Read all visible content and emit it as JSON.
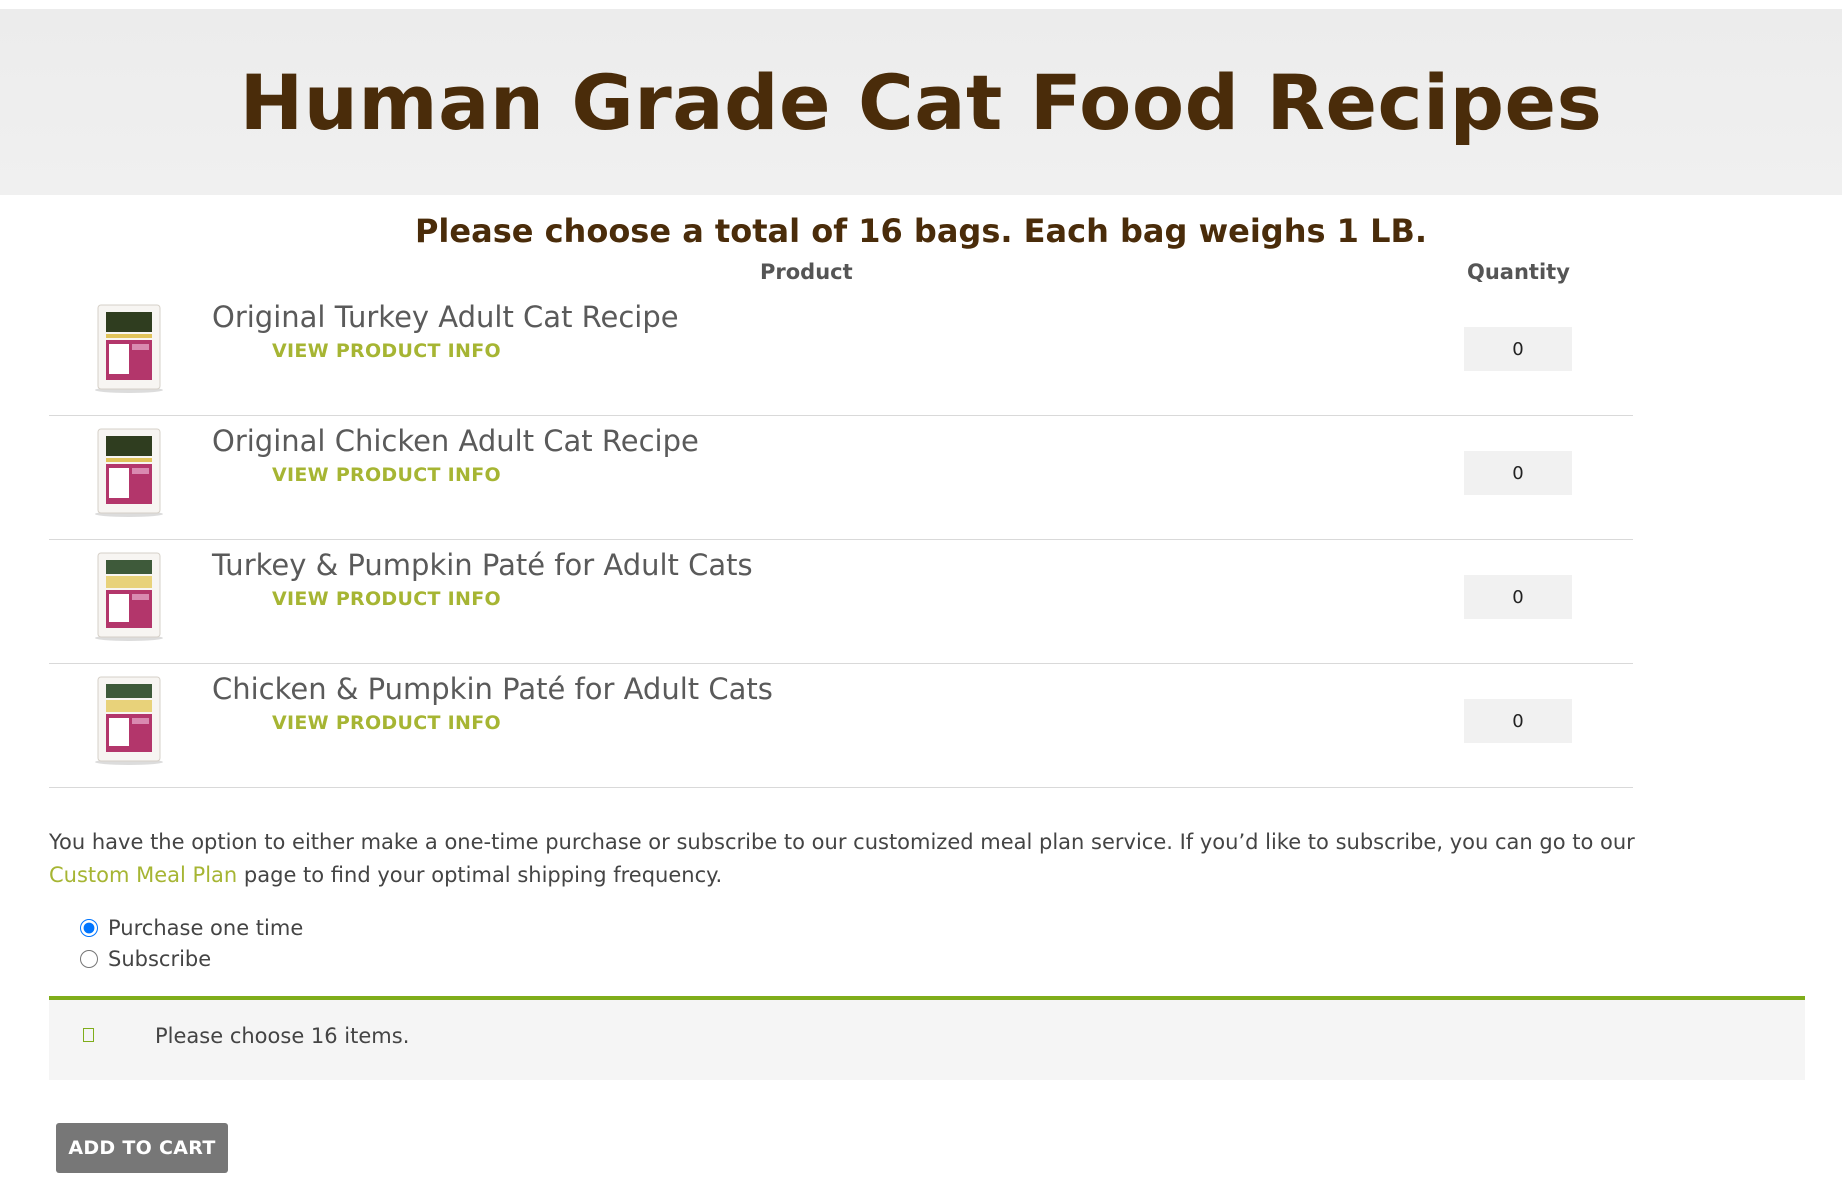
{
  "header": {
    "title": "Human Grade Cat Food Recipes"
  },
  "intro": {
    "subtitle": "Please choose a total of 16 bags. Each bag weighs 1 LB."
  },
  "table": {
    "col_product": "Product",
    "col_quantity": "Quantity",
    "rows": [
      {
        "name": "Original Turkey Adult Cat Recipe",
        "info": "VIEW PRODUCT INFO",
        "qty": "0",
        "band": "#2f3d1f"
      },
      {
        "name": "Original Chicken Adult Cat Recipe",
        "info": "VIEW PRODUCT INFO",
        "qty": "0",
        "band": "#2f3d1f"
      },
      {
        "name": "Turkey & Pumpkin Paté for Adult Cats",
        "info": "VIEW PRODUCT INFO",
        "qty": "0",
        "band": "#e8d27a"
      },
      {
        "name": "Chicken & Pumpkin Paté for Adult Cats",
        "info": "VIEW PRODUCT INFO",
        "qty": "0",
        "band": "#e8d27a"
      }
    ]
  },
  "note": {
    "text_before": "You have the option to either make a one-time purchase or subscribe to our customized meal plan service. If you’d like to subscribe, you can go to our",
    "link": "Custom Meal Plan",
    "text_after": "page to find your optimal shipping frequency."
  },
  "purchase_options": {
    "one_time": "Purchase one time",
    "subscribe": "Subscribe",
    "selected": "one_time"
  },
  "notice": {
    "text": "Please choose 16 items."
  },
  "cart": {
    "button": "ADD TO CART"
  },
  "colors": {
    "title_brown": "#4a2c0a",
    "link_green": "#a6b533",
    "notice_border": "#7fad1a",
    "button_gray": "#777777",
    "bag_magenta": "#b3366b"
  }
}
